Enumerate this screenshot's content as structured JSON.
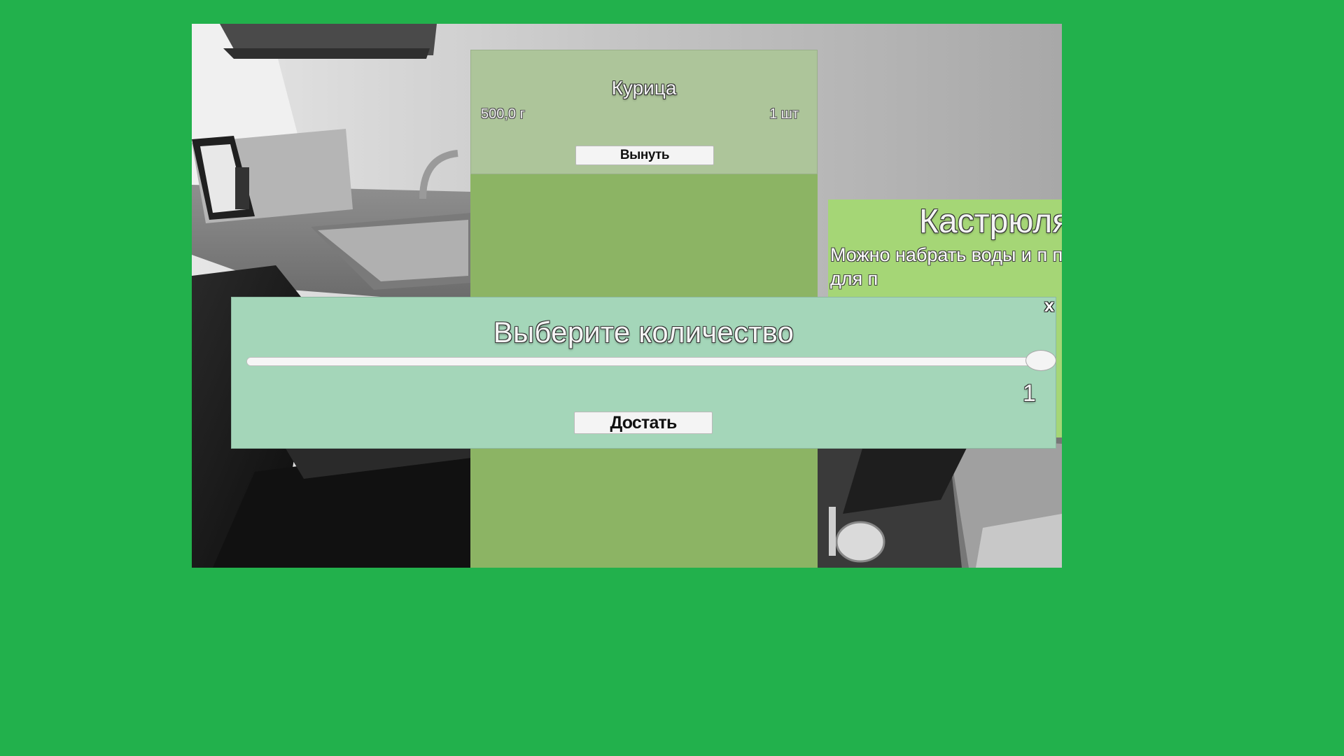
{
  "fridge": {
    "item": {
      "name": "Курица",
      "weight": "500,0 г",
      "count": "1 шт",
      "remove_label": "Вынуть"
    }
  },
  "pot_info": {
    "title": "Кастрюля",
    "description": "Можно набрать воды и п плите. Нажмите G для п"
  },
  "quantity_dialog": {
    "title": "Выберите количество",
    "value": "1",
    "slider_fraction": 1.0,
    "take_label": "Достать",
    "close_label": "x"
  },
  "colors": {
    "background": "#22b14c",
    "fridge_panel": "#8cb464",
    "item_card": "#adc59a",
    "pot_panel": "#a5d676",
    "dialog": "#a4d6b9"
  }
}
